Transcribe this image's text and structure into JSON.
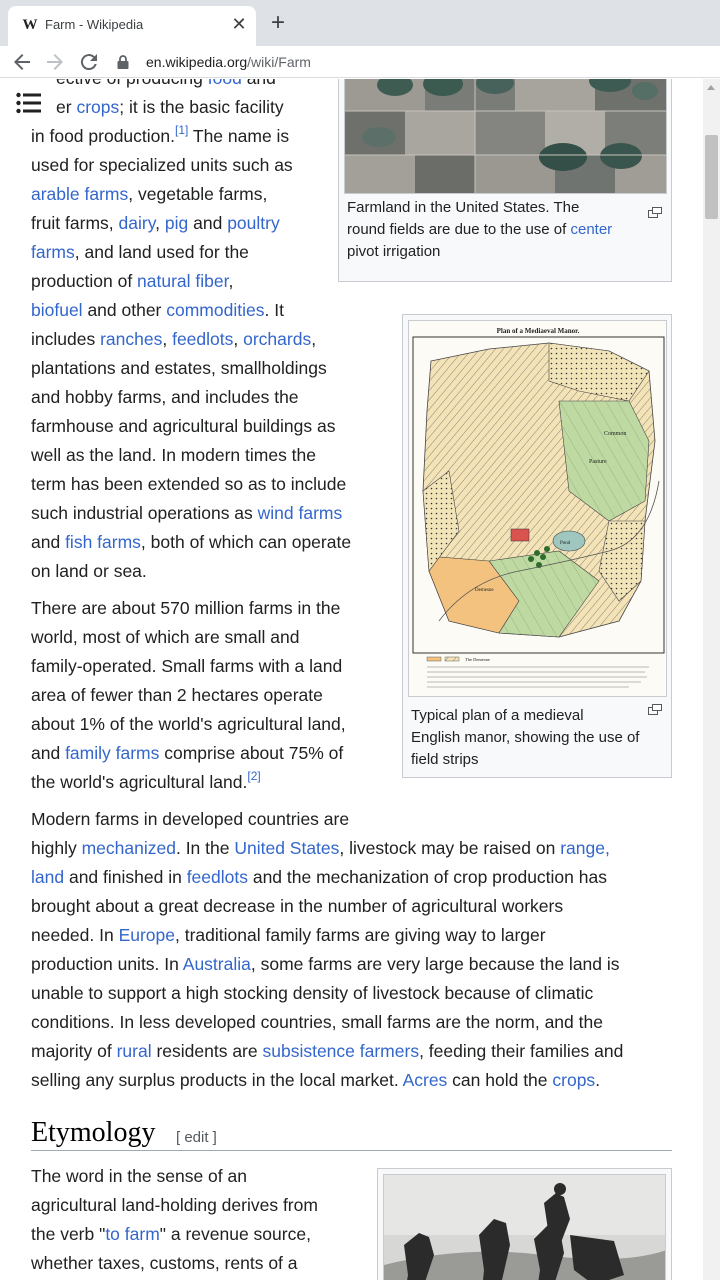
{
  "browser": {
    "tab_title": "Farm - Wikipedia",
    "tab_favicon": "W",
    "tab_close": "✕",
    "new_tab": "+",
    "url_host": "en.wikipedia.org",
    "url_path": "/wiki/Farm"
  },
  "article": {
    "p1": {
      "l0": [
        "ective of producing ",
        "food",
        " and"
      ],
      "l1": [
        "er ",
        "crops",
        "; it is the basic facility"
      ],
      "l2a": "in food production.",
      "l2sup": "[1]",
      "l2b": " The name is",
      "l3": "used for specialized units such as",
      "l4": [
        "arable farms",
        ", vegetable farms,"
      ],
      "l5": [
        "fruit farms, ",
        "dairy",
        ", ",
        "pig",
        " and ",
        "poultry"
      ],
      "l6": [
        "farms",
        ", and land used for the"
      ],
      "l7": [
        "production of ",
        "natural fiber",
        ","
      ],
      "l8": [
        "biofuel",
        " and other ",
        "commodities",
        ". It"
      ],
      "l9": [
        "includes ",
        "ranches",
        ", ",
        "feedlots",
        ", ",
        "orchards",
        ","
      ],
      "l10": "plantations and estates, smallholdings",
      "l11": "and hobby farms, and includes the",
      "l12": "farmhouse and agricultural buildings as",
      "l13": "well as the land. In modern times the",
      "l14": "term has been extended so as to include",
      "l15": [
        "such industrial operations as ",
        "wind farms"
      ],
      "l16": [
        "and ",
        "fish farms",
        ", both of which can operate"
      ],
      "l17": "on land or sea."
    },
    "p2": {
      "l0": "There are about 570 million farms in the",
      "l1": "world, most of which are small and",
      "l2": "family-operated. Small farms with a land",
      "l3": "area of fewer than 2 hectares operate",
      "l4": "about 1% of the world's agricultural land,",
      "l5": [
        "and ",
        "family farms",
        " comprise about 75% of"
      ],
      "l6a": "the world's agricultural land.",
      "l6sup": "[2]"
    },
    "p3": {
      "l0": "Modern farms in developed countries are",
      "l1": [
        "highly ",
        "mechanized",
        ". In the ",
        "United States",
        ", livestock may be raised on ",
        "range,"
      ],
      "l2": [
        "land",
        " and finished in ",
        "feedlots",
        " and the mechanization of crop production has"
      ],
      "l3": "brought about a great decrease in the number of agricultural workers",
      "l4": [
        "needed. In ",
        "Europe",
        ", traditional family farms are giving way to larger"
      ],
      "l5": [
        "production units. In ",
        "Australia",
        ", some farms are very large because the land is"
      ],
      "l6": "unable to support a high stocking density of livestock because of climatic",
      "l7": "conditions. In less developed countries, small farms are the norm, and the",
      "l8": [
        "majority of ",
        "rural",
        " residents are ",
        "subsistence farmers",
        ", feeding their families and"
      ],
      "l9": [
        "selling any surplus products in the local market. ",
        "Acres",
        " can hold the ",
        "crops",
        "."
      ]
    },
    "etymology": {
      "heading": "Etymology",
      "edit": "[ edit ]",
      "l0": "The word in the sense of an",
      "l1": "agricultural land-holding derives from",
      "l2": [
        "the verb \"",
        "to farm",
        "\" a revenue source,"
      ],
      "l3": "whether taxes, customs, rents of a"
    }
  },
  "figures": {
    "aerial": {
      "caption_l0": "Farmland in the United States. The",
      "caption_l1": [
        "round fields are due to the use of ",
        "center"
      ],
      "caption_l2": "pivot irrigation"
    },
    "manor": {
      "map_title": "Plan of a Mediaeval Manor.",
      "map_labels": [
        "Common",
        "Pasture",
        "Pond",
        "Demesne",
        "The Demesne"
      ],
      "caption_l0": "Typical plan of a medieval",
      "caption_l1": "English manor, showing the use of",
      "caption_l2": "field strips"
    }
  },
  "icons": {
    "menu": "menu-icon",
    "back": "arrow-left-icon",
    "forward": "arrow-right-icon",
    "reload": "reload-icon",
    "lock": "lock-icon",
    "enlarge": "enlarge-icon"
  },
  "colors": {
    "link": "#3366cc",
    "text": "#202122",
    "tabbar": "#dee1e6"
  }
}
